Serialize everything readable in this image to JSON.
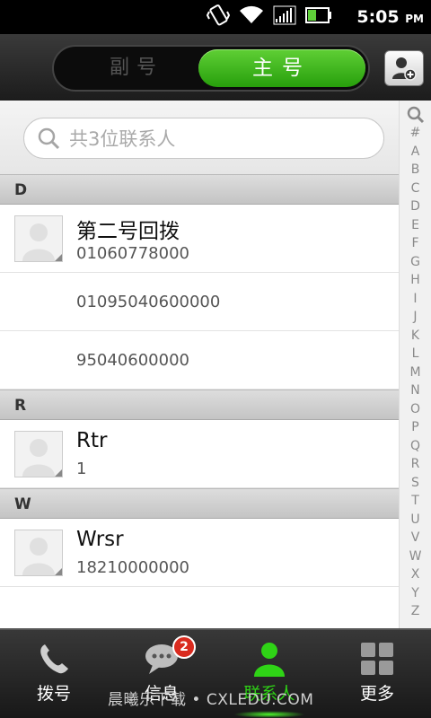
{
  "status": {
    "time": "5:05",
    "ampm": "PM"
  },
  "tabs": {
    "secondary": "副号",
    "primary": "主号"
  },
  "search": {
    "placeholder": "共3位联系人"
  },
  "sections": [
    {
      "letter": "D"
    },
    {
      "letter": "R"
    },
    {
      "letter": "W"
    }
  ],
  "contacts": {
    "d1": {
      "name": "第二号回拨",
      "number": "01060778000"
    },
    "d_extra1": {
      "number": "01095040600000"
    },
    "d_extra2": {
      "number": "95040600000"
    },
    "r1": {
      "name": "Rtr",
      "number": "1"
    },
    "w1": {
      "name": "Wrsr",
      "number": "18210000000"
    }
  },
  "index_letters": [
    "#",
    "A",
    "B",
    "C",
    "D",
    "E",
    "F",
    "G",
    "H",
    "I",
    "J",
    "K",
    "L",
    "M",
    "N",
    "O",
    "P",
    "Q",
    "R",
    "S",
    "T",
    "U",
    "V",
    "W",
    "X",
    "Y",
    "Z"
  ],
  "bottom_nav": {
    "dial": "拨号",
    "messages": "信息",
    "messages_badge": "2",
    "contacts": "联系人",
    "more": "更多"
  },
  "watermark": "晨曦乐下载 • CXLEDU.COM",
  "colors": {
    "accent": "#2fd316",
    "badge": "#d92b1f"
  }
}
